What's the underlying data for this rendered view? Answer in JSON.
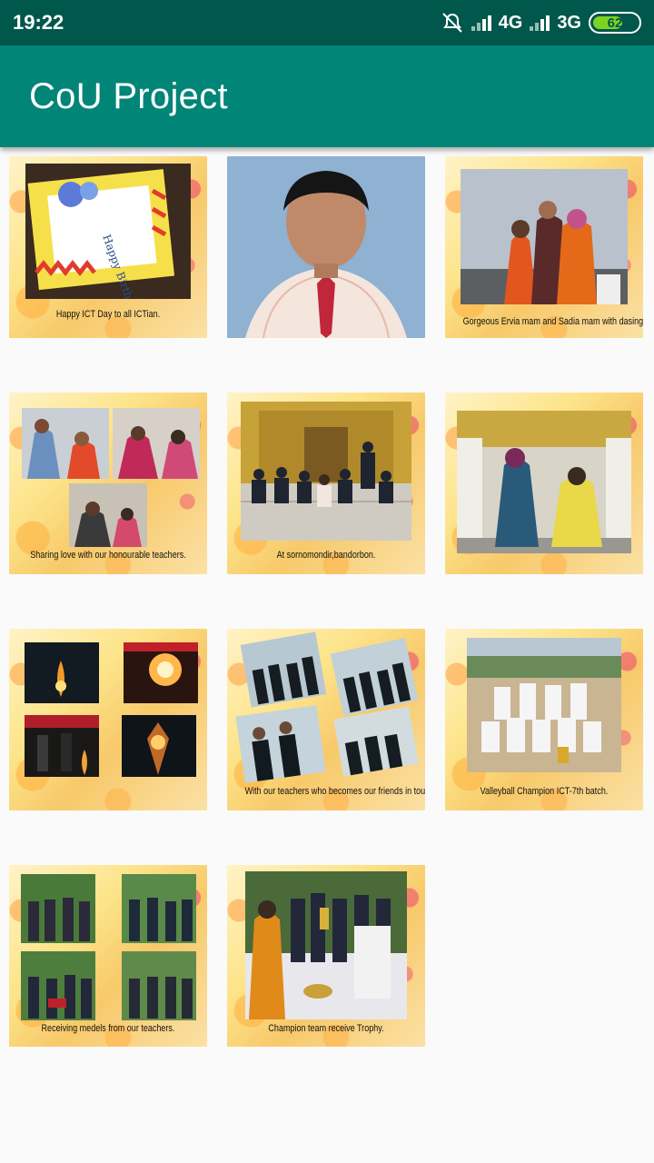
{
  "status_bar": {
    "time": "19:22",
    "network_1": "4G",
    "network_2": "3G",
    "battery": "62",
    "icons": [
      "mute-icon",
      "signal-icon",
      "signal-icon",
      "battery-icon"
    ]
  },
  "app_bar": {
    "title": "CoU Project",
    "color": "#008577"
  },
  "gallery": {
    "items": [
      {
        "caption": "Happy ICT Day to all ICTian."
      },
      {
        "caption": ""
      },
      {
        "caption": "Gorgeous Ervia mam and Sadia mam with dasing Istiaq Sir"
      },
      {
        "caption": "Sharing love with our honourable teachers."
      },
      {
        "caption": "At sornomondir,bandorbon."
      },
      {
        "caption": ""
      },
      {
        "caption": ""
      },
      {
        "caption": "With our teachers who becomes our friends in tour."
      },
      {
        "caption": "Valleyball Champion ICT-7th batch."
      },
      {
        "caption": "Receiving medels from our teachers."
      },
      {
        "caption": "Champion team receive Trophy."
      }
    ]
  }
}
